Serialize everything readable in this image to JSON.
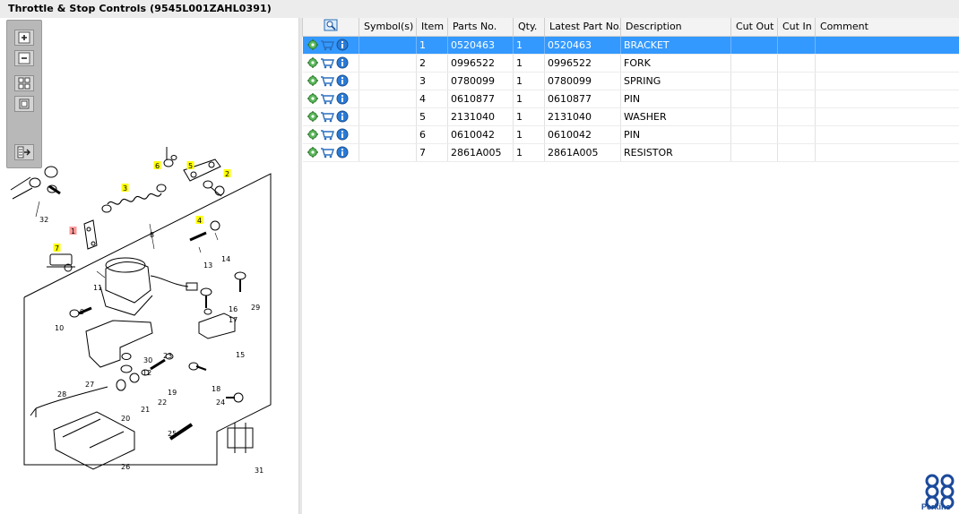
{
  "window": {
    "title": "Throttle & Stop Controls (9545L001ZAHL0391)"
  },
  "toolbar": {
    "buttons": [
      {
        "icon": "zoom-in-icon"
      },
      {
        "icon": "zoom-out-icon"
      },
      {
        "icon": "fit-page-icon"
      },
      {
        "icon": "actual-size-icon"
      },
      {
        "icon": "show-list-icon"
      }
    ]
  },
  "diagram": {
    "callouts": [
      "32",
      "7",
      "1",
      "3",
      "6",
      "5",
      "2",
      "4",
      "8",
      "14",
      "13",
      "11",
      "29",
      "16",
      "17",
      "9",
      "10",
      "15",
      "23",
      "30",
      "12",
      "19",
      "27",
      "18",
      "28",
      "22",
      "21",
      "20",
      "24",
      "25",
      "26",
      "31"
    ],
    "highlighted_callouts": [
      "7",
      "3",
      "6",
      "5",
      "2",
      "4"
    ],
    "selected_callout": "1"
  },
  "table": {
    "columns": [
      "",
      "Symbol(s)",
      "Item",
      "Parts No.",
      "Qty.",
      "Latest Part No.",
      "Description",
      "Cut Out",
      "Cut In",
      "Comment"
    ],
    "rows": [
      {
        "symbols": "",
        "item": "1",
        "part_no": "0520463",
        "qty": "1",
        "latest": "0520463",
        "desc": "BRACKET",
        "cut_out": "",
        "cut_in": "",
        "comment": ""
      },
      {
        "symbols": "",
        "item": "2",
        "part_no": "0996522",
        "qty": "1",
        "latest": "0996522",
        "desc": "FORK",
        "cut_out": "",
        "cut_in": "",
        "comment": ""
      },
      {
        "symbols": "",
        "item": "3",
        "part_no": "0780099",
        "qty": "1",
        "latest": "0780099",
        "desc": "SPRING",
        "cut_out": "",
        "cut_in": "",
        "comment": ""
      },
      {
        "symbols": "",
        "item": "4",
        "part_no": "0610877",
        "qty": "1",
        "latest": "0610877",
        "desc": "PIN",
        "cut_out": "",
        "cut_in": "",
        "comment": ""
      },
      {
        "symbols": "",
        "item": "5",
        "part_no": "2131040",
        "qty": "1",
        "latest": "2131040",
        "desc": "WASHER",
        "cut_out": "",
        "cut_in": "",
        "comment": ""
      },
      {
        "symbols": "",
        "item": "6",
        "part_no": "0610042",
        "qty": "1",
        "latest": "0610042",
        "desc": "PIN",
        "cut_out": "",
        "cut_in": "",
        "comment": ""
      },
      {
        "symbols": "",
        "item": "7",
        "part_no": "2861A005",
        "qty": "1",
        "latest": "2861A005",
        "desc": "RESISTOR",
        "cut_out": "",
        "cut_in": "",
        "comment": ""
      }
    ],
    "selected_row": 0,
    "row_icons": [
      "settings-icon",
      "cart-icon",
      "info-icon"
    ]
  },
  "brand": {
    "name": "Perkins"
  },
  "colors": {
    "selection": "#3399ff",
    "callout_highlight": "#ffff00",
    "callout_selected": "#ff9999",
    "brand": "#1b4a9b"
  }
}
